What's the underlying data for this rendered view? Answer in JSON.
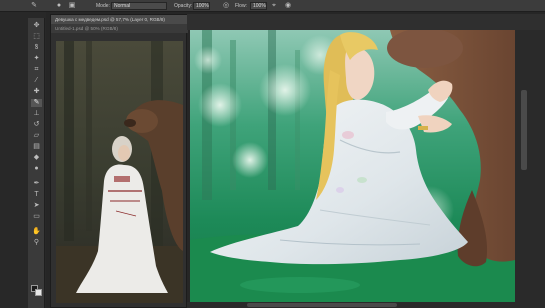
{
  "options_bar": {
    "mode_label": "Mode:",
    "mode_value": "Normal",
    "opacity_label": "Opacity:",
    "opacity_value": "100%",
    "flow_label": "Flow:",
    "flow_value": "100%"
  },
  "reference_document": {
    "title": "Девушка с медведем.psd @ 57,7% (Layer 0, RGB/8)",
    "subtitle": "Untitled-1.psd @ 50% (RGB/8)"
  },
  "colors": {
    "ui_dark": "#282828",
    "panel": "#3a3a3a",
    "forest_green": "#1f8f5a",
    "bear_brown": "#7a5238",
    "dress_white": "#e8ecef",
    "hair_blond": "#e2c25a"
  },
  "icons": {
    "options_bar": [
      "brush-tool-icon",
      "brush-preset-icon",
      "brush-panel-icon",
      "pressure-opacity-icon",
      "airbrush-icon",
      "pressure-size-icon"
    ],
    "tools": [
      "move-icon",
      "marquee-icon",
      "lasso-icon",
      "quick-select-icon",
      "crop-icon",
      "eyedropper-icon",
      "healing-brush-icon",
      "brush-icon",
      "clone-stamp-icon",
      "history-brush-icon",
      "eraser-icon",
      "gradient-icon",
      "blur-icon",
      "dodge-icon",
      "pen-icon",
      "type-icon",
      "path-select-icon",
      "shape-icon",
      "hand-icon",
      "zoom-icon"
    ]
  }
}
